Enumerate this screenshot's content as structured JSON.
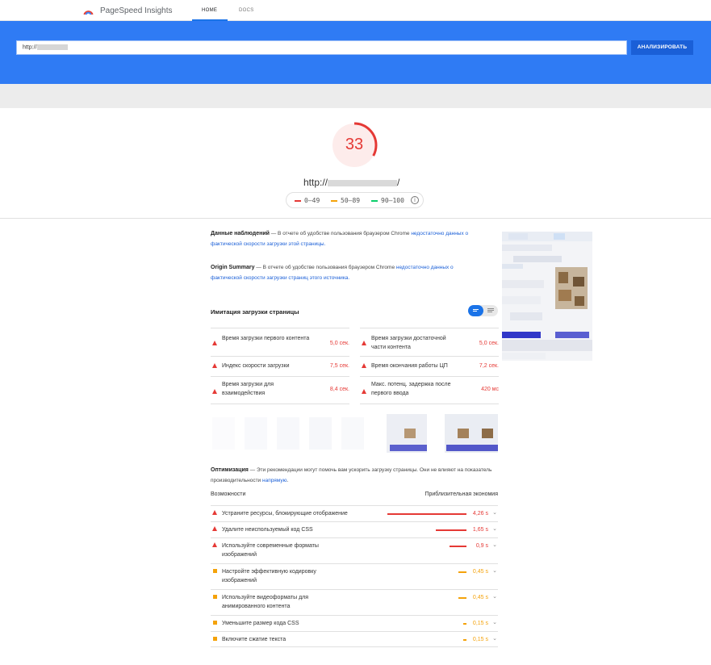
{
  "nav": {
    "brand": "PageSpeed Insights",
    "tabs": [
      {
        "label": "HOME"
      },
      {
        "label": "DOCS"
      }
    ]
  },
  "search": {
    "url_prefix": "http://",
    "button": "АНАЛИЗИРОВАТЬ"
  },
  "score": {
    "value": 33,
    "color": "#e53935",
    "url_prefix": "http://",
    "url_suffix": "/"
  },
  "legend": [
    {
      "label": "0–49",
      "color": "#e53935"
    },
    {
      "label": "50–89",
      "color": "#f4a20a"
    },
    {
      "label": "90–100",
      "color": "#0cce6b"
    }
  ],
  "field_data": {
    "title": "Данные наблюдений",
    "text": " — В отчете об удобстве пользования браузером Chrome ",
    "link": "недостаточно данных о фактической скорости загрузки этой страницы."
  },
  "origin_summary": {
    "title": "Origin Summary",
    "text": " — В отчете об удобстве пользования браузером Chrome ",
    "link": "недостаточно данных о фактической скорости загрузки страниц этого источника."
  },
  "lab": {
    "title": "Имитация загрузки страницы",
    "metrics": [
      {
        "label": "Время загрузки первого контента",
        "value": "5,0 сек."
      },
      {
        "label": "Время загрузки достаточной части контента",
        "value": "5,0 сек."
      },
      {
        "label": "Индекс скорости загрузки",
        "value": "7,5 сек."
      },
      {
        "label": "Время окончания работы ЦП",
        "value": "7,2 сек."
      },
      {
        "label": "Время загрузки для взаимодействия",
        "value": "8,4 сек."
      },
      {
        "label": "Макс. потенц. задержка после первого ввода",
        "value": "420 мс"
      }
    ]
  },
  "optimization": {
    "title": "Оптимизация",
    "text": " — Эти рекомендации могут помочь вам ускорить загрузку страницы. Они не влияют на показатель производительности ",
    "link": "напрямую",
    "text_end": ".",
    "col_left": "Возможности",
    "col_right": "Приблизительная экономия",
    "items": [
      {
        "label": "Устраните ресурсы, блокирующие отображение",
        "value": "4,26 s",
        "savings_s": 4.26,
        "severity": "red"
      },
      {
        "label": "Удалите неиспользуемый код CSS",
        "value": "1,65 s",
        "savings_s": 1.65,
        "severity": "red"
      },
      {
        "label": "Используйте современные форматы изображений",
        "value": "0,9 s",
        "savings_s": 0.9,
        "severity": "red"
      },
      {
        "label": "Настройте эффективную кодировку изображений",
        "value": "0,45 s",
        "savings_s": 0.45,
        "severity": "orange"
      },
      {
        "label": "Используйте видеоформаты для анимированного контента",
        "value": "0,45 s",
        "savings_s": 0.45,
        "severity": "orange"
      },
      {
        "label": "Уменьшите размер кода CSS",
        "value": "0,15 s",
        "savings_s": 0.15,
        "severity": "orange"
      },
      {
        "label": "Включите сжатие текста",
        "value": "0,15 s",
        "savings_s": 0.15,
        "severity": "orange"
      }
    ]
  },
  "colors": {
    "accent": "#2f7bf4",
    "button": "#1a5fd7",
    "fail": "#e53935",
    "average": "#f4a20a",
    "pass": "#0cce6b"
  }
}
